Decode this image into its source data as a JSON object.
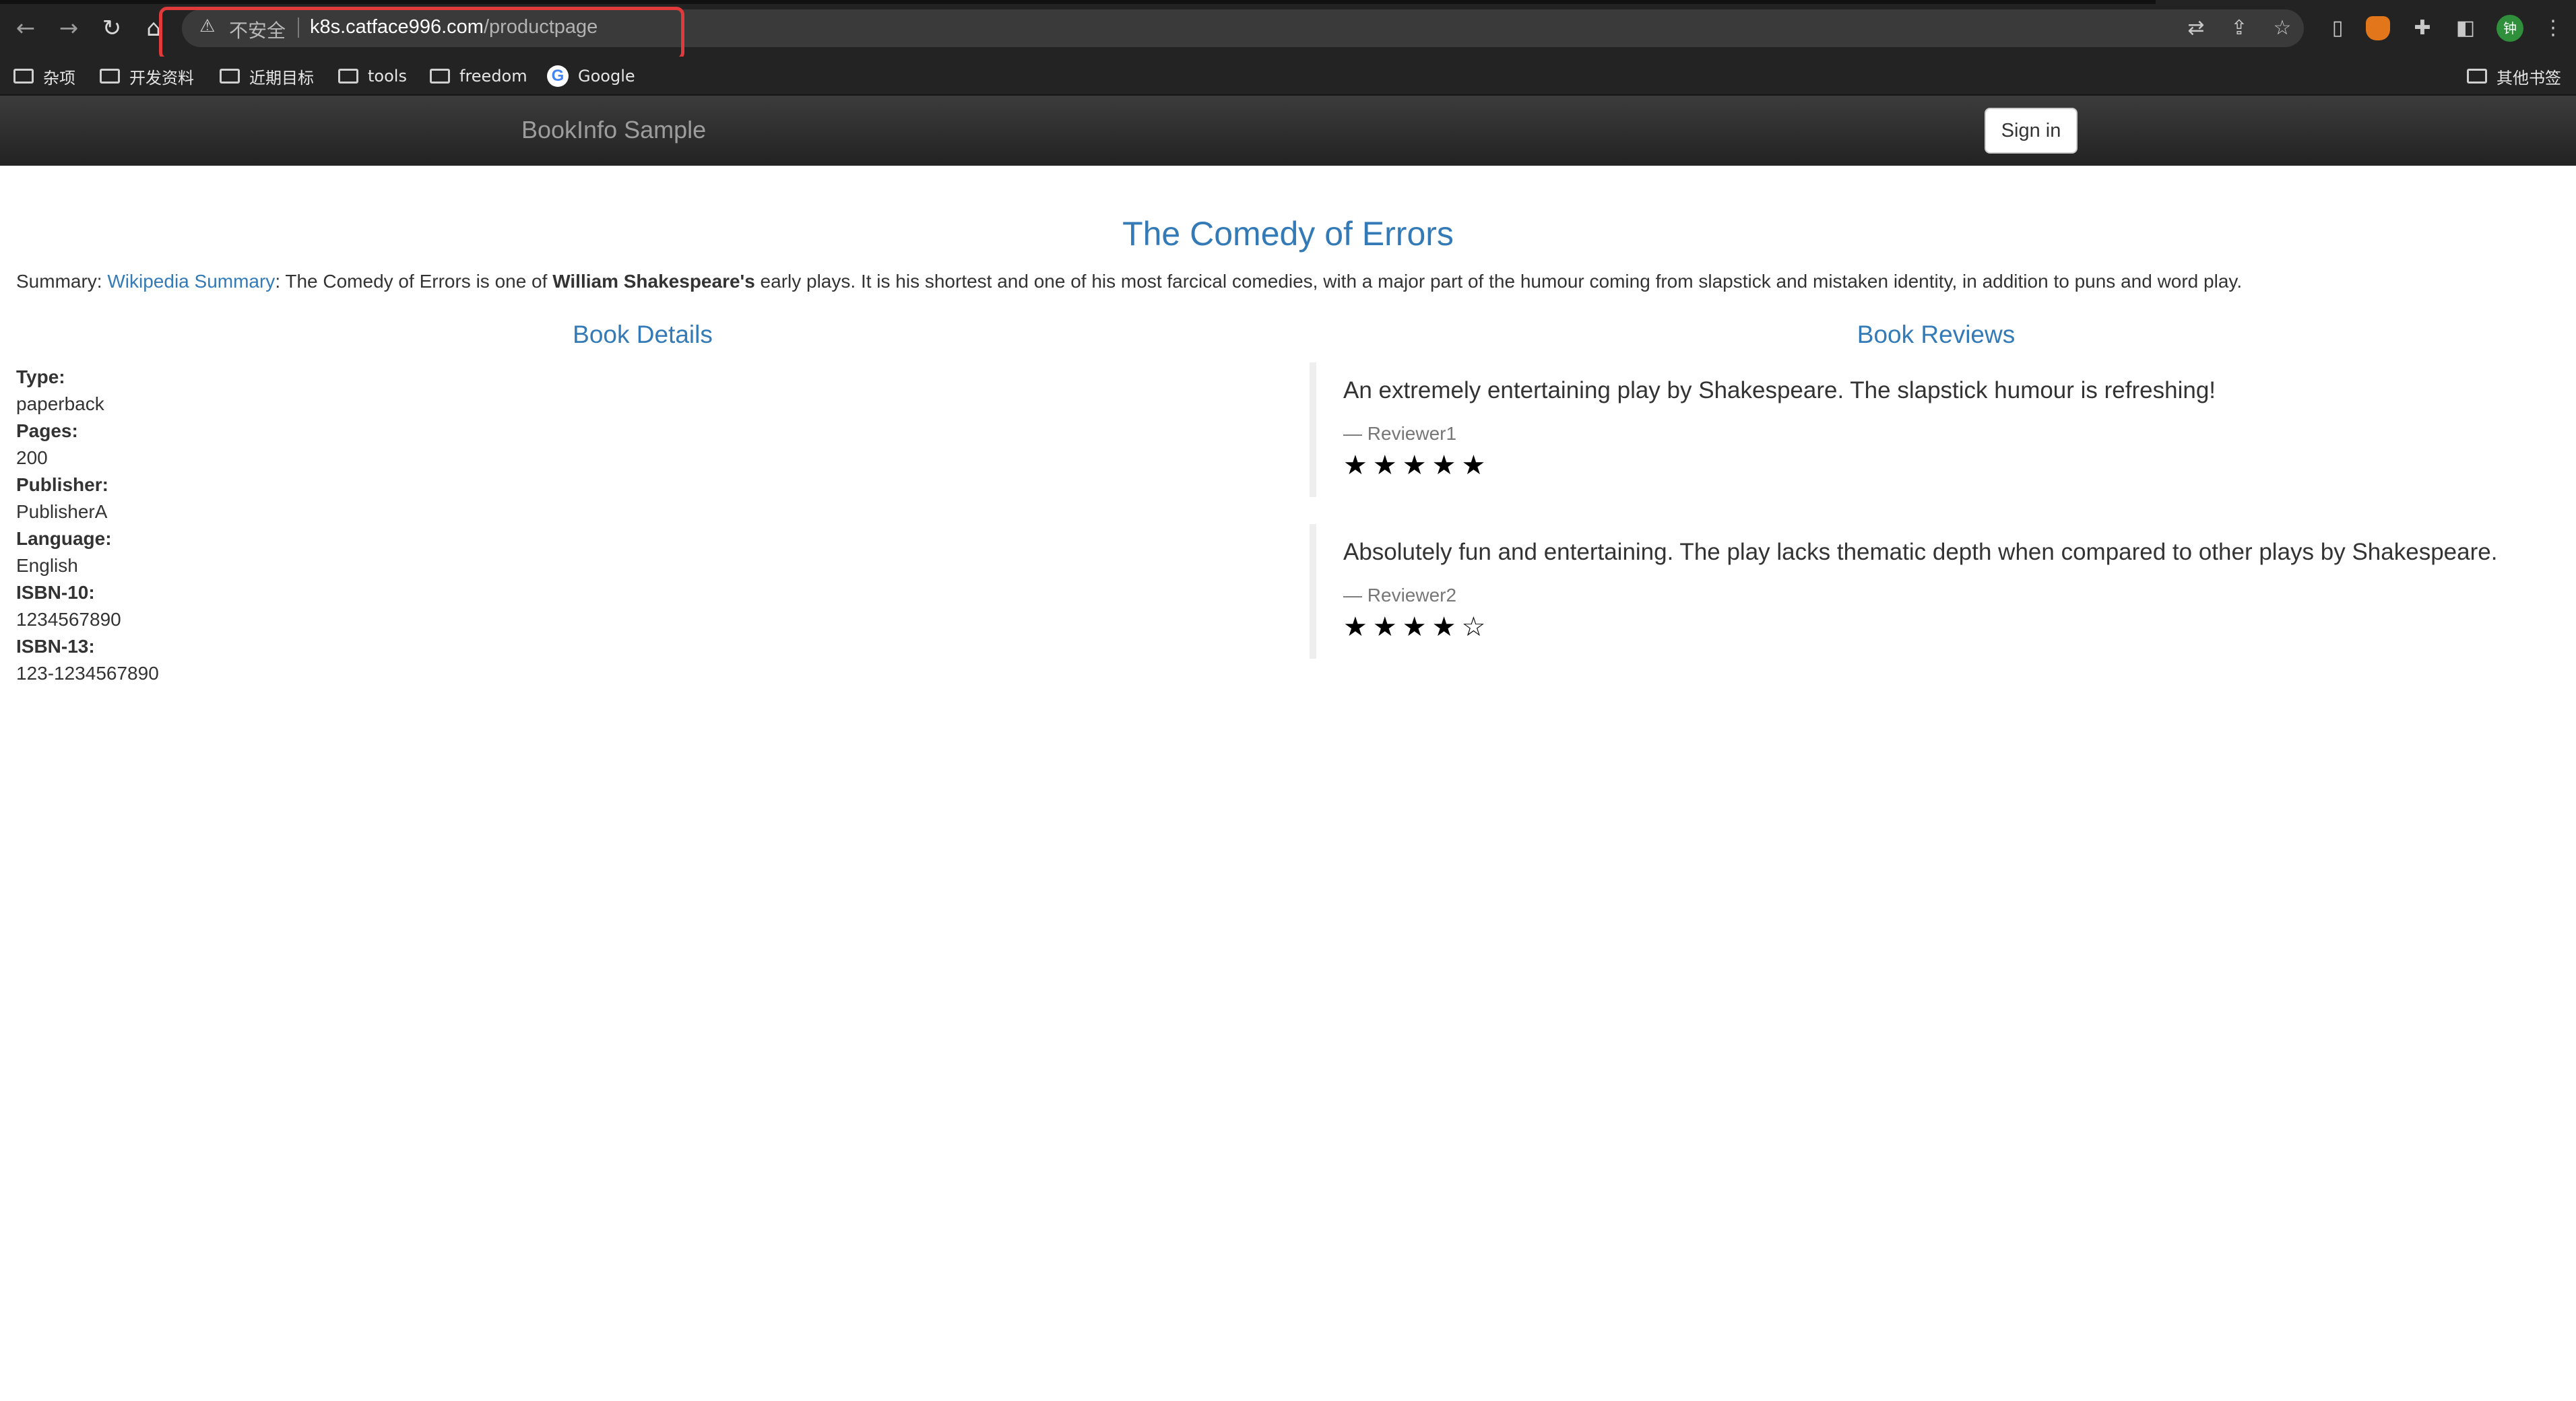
{
  "browser": {
    "security_label": "不安全",
    "url_host": "k8s.catface996.com",
    "url_path": "/productpage",
    "bookmarks": [
      {
        "label": "杂项",
        "icon": "folder-icon"
      },
      {
        "label": "开发资料",
        "icon": "folder-icon"
      },
      {
        "label": "近期目标",
        "icon": "folder-icon"
      },
      {
        "label": "tools",
        "icon": "folder-icon"
      },
      {
        "label": "freedom",
        "icon": "folder-icon"
      },
      {
        "label": "Google",
        "icon": "google-icon"
      }
    ],
    "other_bookmarks": "其他书签",
    "profile_initial": "钟"
  },
  "navbar": {
    "brand": "BookInfo Sample",
    "signin": "Sign in"
  },
  "product": {
    "title": "The Comedy of Errors",
    "summary_prefix": "Summary: ",
    "summary_link": "Wikipedia Summary",
    "summary_mid": ": The Comedy of Errors is one of ",
    "summary_bold": "William Shakespeare's",
    "summary_rest": " early plays. It is his shortest and one of his most farcical comedies, with a major part of the humour coming from slapstick and mistaken identity, in addition to puns and word play."
  },
  "details": {
    "heading": "Book Details",
    "type_label": "Type:",
    "type_value": "paperback",
    "pages_label": "Pages:",
    "pages_value": "200",
    "publisher_label": "Publisher:",
    "publisher_value": "PublisherA",
    "language_label": "Language:",
    "language_value": "English",
    "isbn10_label": "ISBN-10:",
    "isbn10_value": "1234567890",
    "isbn13_label": "ISBN-13:",
    "isbn13_value": "123-1234567890"
  },
  "reviews": {
    "heading": "Book Reviews",
    "items": [
      {
        "text": "An extremely entertaining play by Shakespeare. The slapstick humour is refreshing!",
        "reviewer": "— Reviewer1",
        "stars": "★★★★★",
        "rating": 5
      },
      {
        "text": "Absolutely fun and entertaining. The play lacks thematic depth when compared to other plays by Shakespeare.",
        "reviewer": "— Reviewer2",
        "stars": "★★★★☆",
        "rating": 4
      }
    ]
  }
}
